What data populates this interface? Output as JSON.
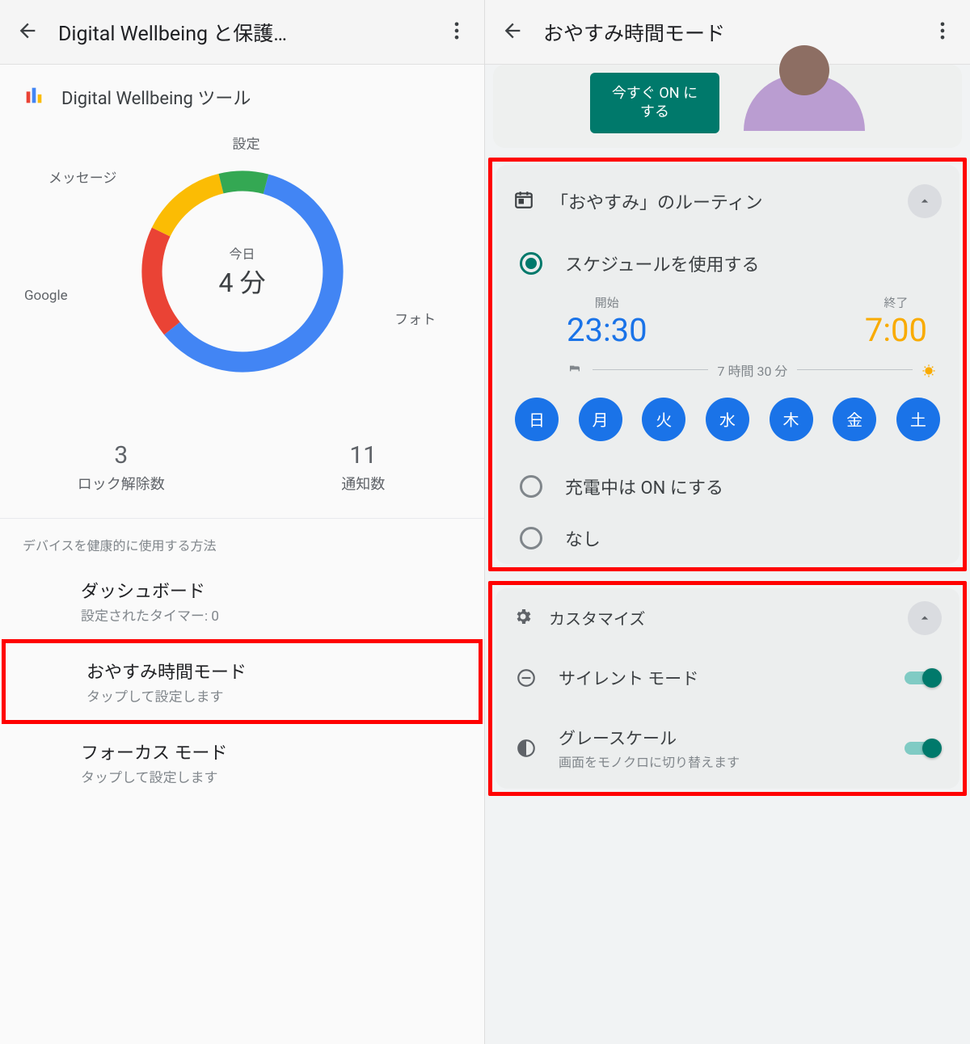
{
  "left": {
    "title": "Digital Wellbeing と保護…",
    "tools_label": "Digital Wellbeing ツール",
    "chart": {
      "date_label": "今日",
      "time_label": "4 分",
      "segments": {
        "settings": "設定",
        "messages": "メッセージ",
        "google": "Google",
        "photos": "フォト"
      }
    },
    "stats": {
      "unlocks_num": "3",
      "unlocks_label": "ロック解除数",
      "notif_num": "11",
      "notif_label": "通知数"
    },
    "usage_section": "デバイスを健康的に使用する方法",
    "items": {
      "dashboard": {
        "title": "ダッシュボード",
        "sub": "設定されたタイマー: 0"
      },
      "bedtime": {
        "title": "おやすみ時間モード",
        "sub": "タップして設定します"
      },
      "focus": {
        "title": "フォーカス モード",
        "sub": "タップして設定します"
      }
    }
  },
  "right": {
    "title": "おやすみ時間モード",
    "on_button_l1": "今すぐ ON に",
    "on_button_l2": "する",
    "routine": {
      "header": "「おやすみ」のルーティン",
      "schedule_label": "スケジュールを使用する",
      "start_label": "開始",
      "start_time": "23:30",
      "end_label": "終了",
      "end_time": "7:00",
      "duration": "7 時間 30 分",
      "days": [
        "日",
        "月",
        "火",
        "水",
        "木",
        "金",
        "土"
      ],
      "charging_label": "充電中は ON にする",
      "none_label": "なし"
    },
    "customize": {
      "header": "カスタマイズ",
      "silent": {
        "title": "サイレント モード"
      },
      "grayscale": {
        "title": "グレースケール",
        "sub": "画面をモノクロに切り替えます"
      }
    }
  },
  "chart_data": {
    "type": "pie",
    "title": "今日 4 分",
    "categories": [
      "フォト",
      "Google",
      "メッセージ",
      "設定"
    ],
    "values": [
      60,
      18,
      14,
      8
    ],
    "colors": [
      "#4285f4",
      "#ea4335",
      "#fbbc04",
      "#34a853"
    ]
  }
}
